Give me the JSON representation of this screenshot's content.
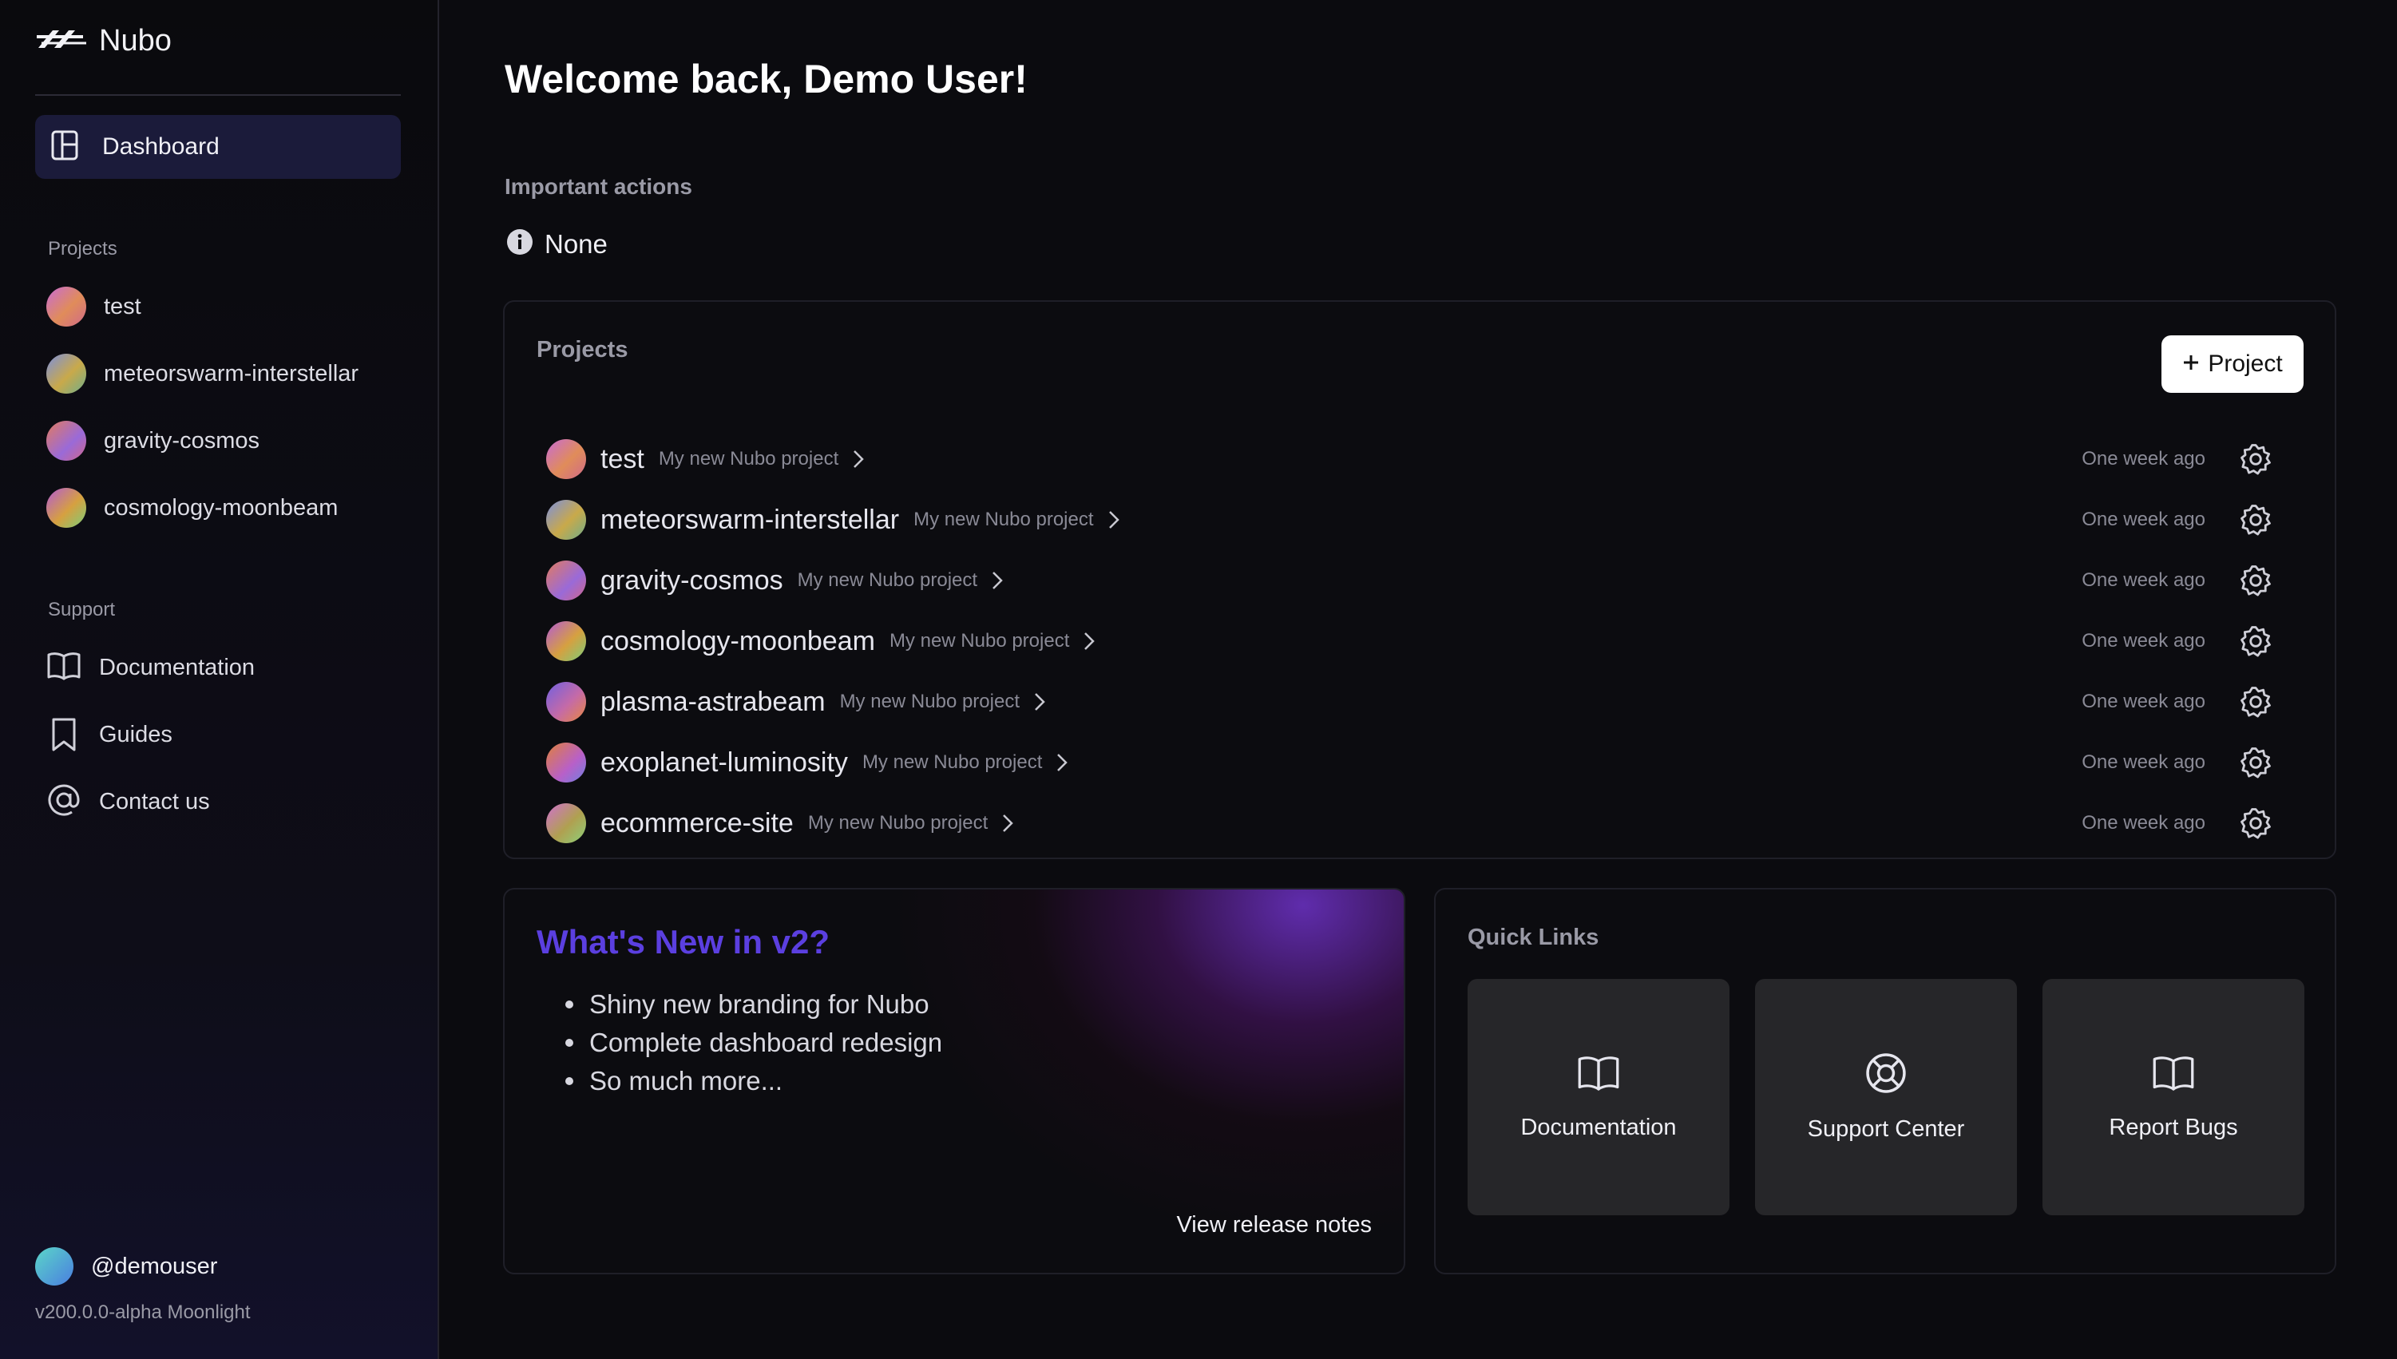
{
  "brand": {
    "name": "Nubo"
  },
  "sidebar": {
    "dashboard_label": "Dashboard",
    "projects_title": "Projects",
    "projects": [
      {
        "label": "test"
      },
      {
        "label": "meteorswarm-interstellar"
      },
      {
        "label": "gravity-cosmos"
      },
      {
        "label": "cosmology-moonbeam"
      }
    ],
    "support_title": "Support",
    "support": [
      {
        "label": "Documentation",
        "icon": "book-open-icon"
      },
      {
        "label": "Guides",
        "icon": "bookmark-icon"
      },
      {
        "label": "Contact us",
        "icon": "at-sign-icon"
      }
    ],
    "username": "@demouser",
    "version": "v200.0.0-alpha Moonlight"
  },
  "main": {
    "welcome": "Welcome back, Demo User!",
    "important_actions": {
      "title": "Important actions",
      "value": "None"
    },
    "projects_card": {
      "title": "Projects",
      "add_button": "Project",
      "rows": [
        {
          "name": "test",
          "description": "My new Nubo project",
          "time": "One week ago"
        },
        {
          "name": "meteorswarm-interstellar",
          "description": "My new Nubo project",
          "time": "One week ago"
        },
        {
          "name": "gravity-cosmos",
          "description": "My new Nubo project",
          "time": "One week ago"
        },
        {
          "name": "cosmology-moonbeam",
          "description": "My new Nubo project",
          "time": "One week ago"
        },
        {
          "name": "plasma-astrabeam",
          "description": "My new Nubo project",
          "time": "One week ago"
        },
        {
          "name": "exoplanet-luminosity",
          "description": "My new Nubo project",
          "time": "One week ago"
        },
        {
          "name": "ecommerce-site",
          "description": "My new Nubo project",
          "time": "One week ago"
        }
      ]
    },
    "whats_new": {
      "title": "What's New in v2?",
      "items": [
        "Shiny new branding for Nubo",
        "Complete dashboard redesign",
        "So much more..."
      ],
      "release_notes": "View release notes"
    },
    "quick_links": {
      "title": "Quick Links",
      "tiles": [
        {
          "label": "Documentation",
          "icon": "book-open-icon"
        },
        {
          "label": "Support Center",
          "icon": "life-buoy-icon"
        },
        {
          "label": "Report Bugs",
          "icon": "book-open-icon"
        }
      ]
    }
  },
  "colors": {
    "accent": "#5b3fe0",
    "nav_active": "#1b1b3a",
    "background": "#0b0b0f"
  }
}
